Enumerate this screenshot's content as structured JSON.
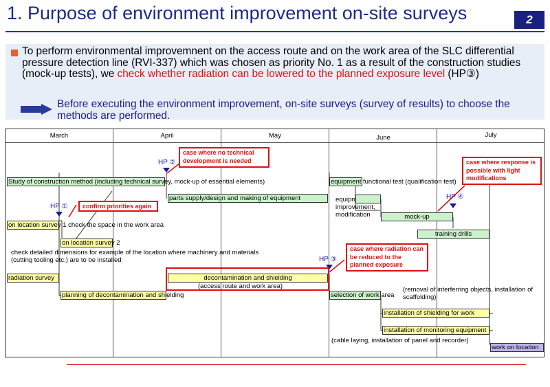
{
  "header": {
    "title": "1. Purpose of environment improvement on-site surveys",
    "page_number": "2"
  },
  "intro": {
    "text_before": "To perform environmental improvemnent on the access route and on the work area of the SLC differential pressure detection line (RVI-337) which was chosen as priority No. 1 as a result of the construction studies (mock-up tests), we ",
    "highlight": "check whether radiation can be lowered to the planned exposure level",
    "text_after": " (HP③)",
    "sub_text": "Before executing the environment improvement, on-site surveys (survey of results) to choose the methods are performed."
  },
  "schedule": {
    "months": [
      "March",
      "April",
      "May",
      "June",
      "July"
    ],
    "bars": {
      "study": "Study of construction method (including technical survey, mock-up of essential elements)",
      "parts_supply": "parts supply/design and making of equipment",
      "location_survey_1": "on location survey 1 check the space in the work area",
      "location_survey_2": "on location survey 2",
      "radiation_survey": "radiation survey",
      "planning": "planning of decontamination and shielding",
      "decon": "decontamination and shielding",
      "equipment": "equipment functional test (qualification test)",
      "mockup": "mock-up",
      "training": "training drills",
      "selection": "selection of work area",
      "install_shielding": "installation of shielding for work",
      "install_monitoring": "installation of monitoring equipment",
      "work_on_location": "work on location"
    },
    "notes": {
      "check_dims": "check detailed dimensions for example of the location where machinery and materials (cutting tooling etc.) are to be installed",
      "access_route": "(access route and work area)",
      "equipment_improve": "equipment improvement, modification",
      "removal": "(removal of interferring objects, installation of scaffolding)",
      "cable": "(cable laying, installation of panel and recorder)"
    },
    "callouts": {
      "no_tech": "case where no technical development is needed",
      "confirm": "confirm priorities again",
      "reduced": "case where radiation can be reduced to the planned exposure",
      "response": "case where response is possible with light modifications"
    },
    "hold_points": {
      "hp1": "HP ①",
      "hp2": "HP ②",
      "hp3": "HP ③",
      "hp4": "HP ④"
    }
  },
  "colors": {
    "title": "#1a2a8c",
    "accent_red": "#e01010",
    "bar_yellow": "#ffffa8",
    "bar_green": "#ccf2cc",
    "bar_purple": "#c0b4ec"
  }
}
